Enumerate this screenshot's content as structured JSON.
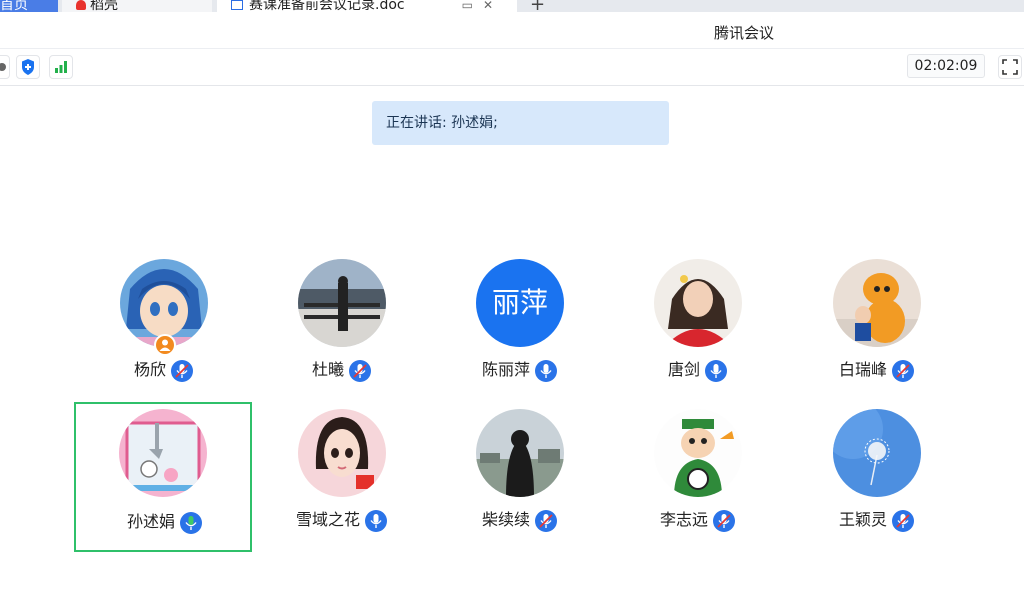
{
  "tabs": {
    "home": "首页",
    "draft": "稻壳",
    "doc": "赛课准备前会议记录.doc",
    "add": "+"
  },
  "app": {
    "title": "腾讯会议"
  },
  "toolbar": {
    "timer": "02:02:09"
  },
  "speaking": {
    "label": "正在讲话:",
    "names": "孙述娟;"
  },
  "colors": {
    "accent": "#1a73f0",
    "active_border": "#2fc06a",
    "speaking_bg": "#d7e8fb",
    "host_badge": "#f28a1f",
    "signal": "#22b04b"
  },
  "participants": [
    {
      "name": "杨欣",
      "host": true,
      "avatar_text": "",
      "mic": "muted-mic-icon"
    },
    {
      "name": "杜曦",
      "host": false,
      "avatar_text": "",
      "mic": "muted-mic-icon"
    },
    {
      "name": "陈丽萍",
      "host": false,
      "avatar_text": "丽萍",
      "mic": "mic-icon"
    },
    {
      "name": "唐剑",
      "host": false,
      "avatar_text": "",
      "mic": "mic-icon"
    },
    {
      "name": "白瑞峰",
      "host": false,
      "avatar_text": "",
      "mic": "muted-mic-icon"
    },
    {
      "name": "孙述娟",
      "host": false,
      "avatar_text": "",
      "mic": "active-mic-icon",
      "active": true
    },
    {
      "name": "雪域之花",
      "host": false,
      "avatar_text": "",
      "mic": "mic-icon"
    },
    {
      "name": "柴续续",
      "host": false,
      "avatar_text": "",
      "mic": "muted-mic-icon"
    },
    {
      "name": "李志远",
      "host": false,
      "avatar_text": "",
      "mic": "muted-mic-icon"
    },
    {
      "name": "王颖灵",
      "host": false,
      "avatar_text": "",
      "mic": "muted-mic-icon"
    }
  ]
}
